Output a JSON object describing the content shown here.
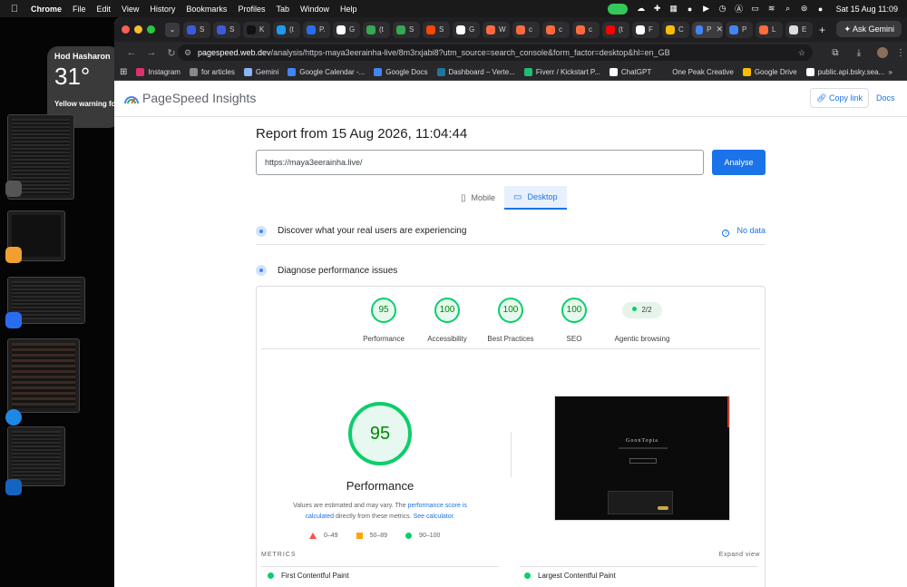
{
  "menubar": {
    "app": "Chrome",
    "items": [
      "File",
      "Edit",
      "View",
      "History",
      "Bookmarks",
      "Profiles",
      "Tab",
      "Window",
      "Help"
    ],
    "datetime": "Sat 15 Aug  11:09",
    "ask_gemini": "Ask Gemini"
  },
  "widget": {
    "city": "Hod Hasharon",
    "temperature": "31°",
    "warning": "Yellow warning for high temperature"
  },
  "browser": {
    "tabs": [
      {
        "label": "S",
        "color": "#3b5bdb"
      },
      {
        "label": "S",
        "color": "#3b5bdb"
      },
      {
        "label": "K",
        "color": "#111111"
      },
      {
        "label": "(t",
        "color": "#1d9bf0"
      },
      {
        "label": "P.",
        "color": "#2a6cf0"
      },
      {
        "label": "G",
        "color": "#ffffff"
      },
      {
        "label": "(t",
        "color": "#34a853"
      },
      {
        "label": "S",
        "color": "#34a853"
      },
      {
        "label": "S",
        "color": "#ff4500"
      },
      {
        "label": "G",
        "color": "#ffffff"
      },
      {
        "label": "W",
        "color": "#ff6b3d"
      },
      {
        "label": "c",
        "color": "#ff6b3d"
      },
      {
        "label": "c",
        "color": "#ff6b3d"
      },
      {
        "label": "c",
        "color": "#ff6b3d"
      },
      {
        "label": "(t",
        "color": "#ff0000"
      },
      {
        "label": "F",
        "color": "#ffffff"
      },
      {
        "label": "C",
        "color": "#fbbc04"
      }
    ],
    "active_tab": "P",
    "trailing_tabs": [
      {
        "label": "P",
        "color": "#4285f4"
      },
      {
        "label": "L",
        "color": "#ff6b3d"
      },
      {
        "label": "E",
        "color": "#dddddd"
      }
    ],
    "url_host": "pagespeed.web.dev",
    "url_path": "/analysis/https-maya3eerainha-live/8m3rxjabi8?utm_source=search_console&form_factor=desktop&hl=en_GB",
    "bookmarks": [
      {
        "label": "Instagram",
        "color": "#e1306c"
      },
      {
        "label": "for articles",
        "color": "#888888"
      },
      {
        "label": "Gemini",
        "color": "#8ab4f8"
      },
      {
        "label": "Google Calendar -...",
        "color": "#4285f4"
      },
      {
        "label": "Google Docs",
        "color": "#4285f4"
      },
      {
        "label": "Dashboard – Verte...",
        "color": "#21759b"
      },
      {
        "label": "Fiverr / Kickstart P...",
        "color": "#1dbf73"
      },
      {
        "label": "ChatGPT",
        "color": "#ffffff"
      },
      {
        "label": "One Peak Creative",
        "color": "#28282a"
      },
      {
        "label": "Google Drive",
        "color": "#fbbc04"
      },
      {
        "label": "public.api.bsky.sea...",
        "color": "#ffffff"
      }
    ]
  },
  "psi": {
    "title": "PageSpeed Insights",
    "copy_link": "Copy link",
    "docs": "Docs",
    "report_title": "Report from 15 Aug 2026, 11:04:44",
    "url_value": "https://maya3eerainha.live/",
    "analyse": "Analyse",
    "mode_mobile": "Mobile",
    "mode_desktop": "Desktop",
    "discover": "Discover what your real users are experiencing",
    "no_data": "No data",
    "diagnose": "Diagnose performance issues",
    "scores": [
      {
        "value": "95",
        "label": "Performance"
      },
      {
        "value": "100",
        "label": "Accessibility"
      },
      {
        "value": "100",
        "label": "Best Practices"
      },
      {
        "value": "100",
        "label": "SEO"
      }
    ],
    "agentic": {
      "value": "2/2",
      "label": "Agentic browsing"
    },
    "perf_score": "95",
    "perf_title": "Performance",
    "perf_note_1": "Values are estimated and may vary. The",
    "perf_note_link1": "performance score is calculated",
    "perf_note_2": "directly from these metrics.",
    "perf_note_link2": "See calculator.",
    "legend": [
      "0–49",
      "50–89",
      "90–100"
    ],
    "screenshot_title": "GoonTopia",
    "metrics_label": "METRICS",
    "expand_view": "Expand view",
    "metric_left": "First Contentful Paint",
    "metric_right": "Largest Contentful Paint"
  },
  "colors": {
    "good": "#0cce6b",
    "average": "#ffa400",
    "fail": "#ff4e42",
    "link": "#1a73e8"
  }
}
